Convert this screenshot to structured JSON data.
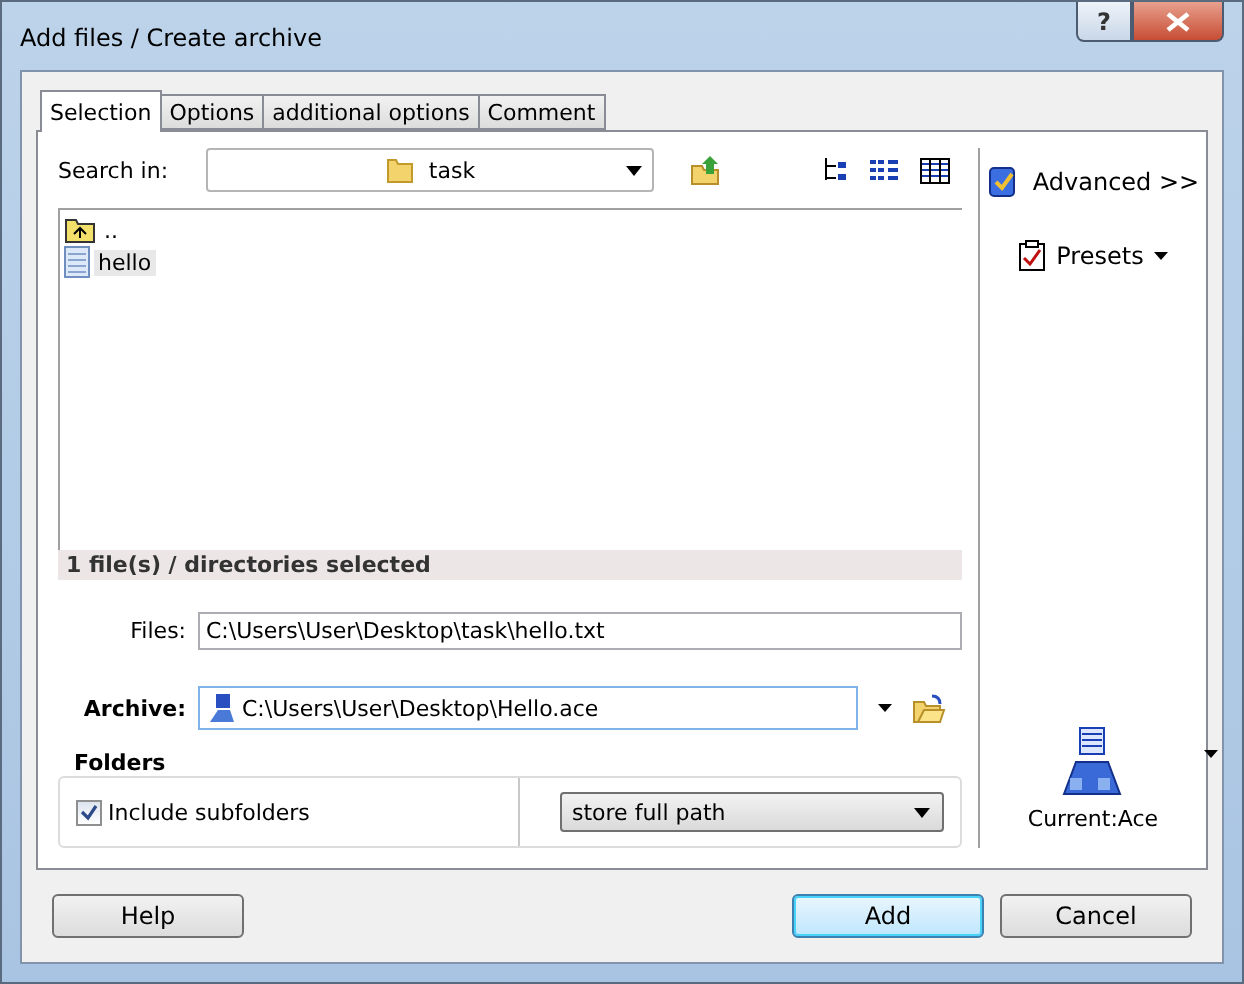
{
  "window": {
    "title": "Add files / Create archive",
    "help_glyph": "?"
  },
  "tabs": [
    {
      "label": "Selection",
      "selected": true
    },
    {
      "label": "Options",
      "selected": false
    },
    {
      "label": "additional options",
      "selected": false
    },
    {
      "label": "Comment",
      "selected": false
    }
  ],
  "search": {
    "label": "Search in:",
    "folder": "task"
  },
  "file_list": [
    {
      "name": "..",
      "kind": "parent",
      "selected": false
    },
    {
      "name": "hello",
      "kind": "file",
      "selected": true
    }
  ],
  "status": "1 file(s) / directories selected",
  "files": {
    "label": "Files:",
    "value": "C:\\Users\\User\\Desktop\\task\\hello.txt"
  },
  "archive": {
    "label": "Archive:",
    "value": "C:\\Users\\User\\Desktop\\Hello.ace"
  },
  "folders": {
    "title": "Folders",
    "include_subfolders": {
      "label": "Include subfolders",
      "checked": true
    },
    "path_mode": "store full path"
  },
  "side": {
    "advanced": "Advanced >>",
    "presets": "Presets",
    "format": "Current:Ace"
  },
  "buttons": [
    {
      "label": "Help",
      "default": false
    },
    {
      "label": "Add",
      "default": true
    },
    {
      "label": "Cancel",
      "default": false
    }
  ]
}
